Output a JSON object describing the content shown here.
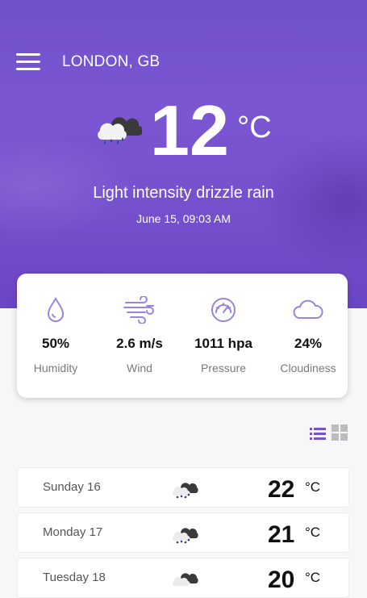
{
  "header": {
    "city": "LONDON, GB",
    "temperature": "12",
    "unit": "°C",
    "description": "Light intensity drizzle rain",
    "datetime": "June 15, 09:03 AM",
    "weather_icon": "cloud-rain-icon"
  },
  "stats": [
    {
      "value": "50%",
      "label": "Humidity",
      "icon": "humidity-drop-icon"
    },
    {
      "value": "2.6 m/s",
      "label": "Wind",
      "icon": "wind-icon"
    },
    {
      "value": "1011 hpa",
      "label": "Pressure",
      "icon": "pressure-gauge-icon"
    },
    {
      "value": "24%",
      "label": "Cloudiness",
      "icon": "cloud-icon"
    }
  ],
  "forecast": [
    {
      "day": "Sunday 16",
      "temp": "22",
      "unit": "°C"
    },
    {
      "day": "Monday 17",
      "temp": "21",
      "unit": "°C"
    },
    {
      "day": "Tuesday 18",
      "temp": "20",
      "unit": "°C"
    }
  ],
  "colors": {
    "primary": "#7752cf",
    "accent_icon": "#9c84dd",
    "grid_icon": "#bdbdbd"
  }
}
